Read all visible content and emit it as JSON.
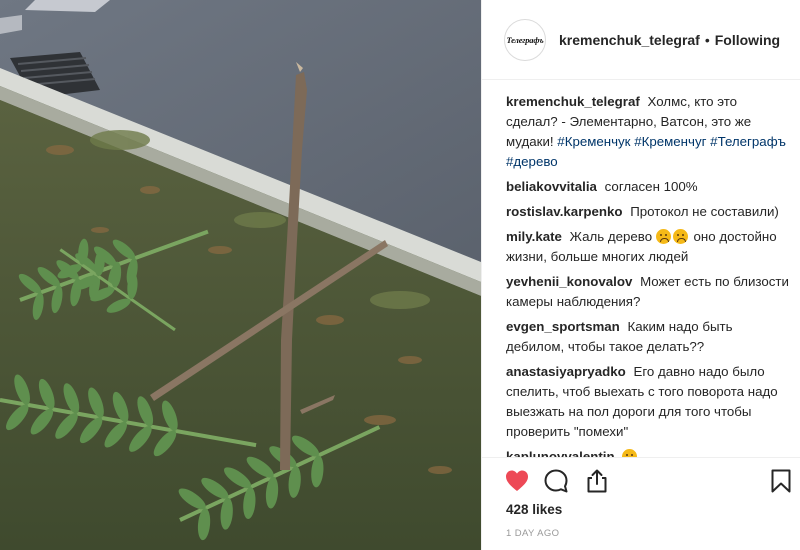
{
  "account": {
    "username": "kremenchuk_telegraf",
    "avatar_logo": "Телеграфъ",
    "follow_status": "Following",
    "separator": "•"
  },
  "comments": [
    {
      "user": "kremenchuk_telegraf",
      "text": "Холмс, кто это сделал? - Элементарно, Ватсон, это же мудаки!",
      "hashtags": [
        "#Кременчук",
        "#Кременчуг",
        "#Телеграфъ",
        "#дерево"
      ]
    },
    {
      "user": "beliakovvitalia",
      "text": "согласен 100%"
    },
    {
      "user": "rostislav.karpenko",
      "text": "Протокол не составили)"
    },
    {
      "user": "mily.kate",
      "text_before": "Жаль дерево",
      "emoji": [
        "sad-face",
        "sad-face"
      ],
      "text_after": "оно достойно жизни, больше многих людей"
    },
    {
      "user": "yevhenii_konovalov",
      "text": "Может есть по близости камеры наблюдения?"
    },
    {
      "user": "evgen_sportsman",
      "text": "Каким надо быть дебилом, чтобы такое делать??"
    },
    {
      "user": "anastasiyapryadko",
      "text": "Его давно надо было спелить, чтоб выехать с того поворота надо выезжать на пол дороги для того чтобы проверить \"помехи\""
    },
    {
      "user": "kaplunovvalentin",
      "emoji": [
        "sad-face"
      ]
    }
  ],
  "actions": {
    "like_icon": "heart-icon",
    "comment_icon": "speech-bubble-icon",
    "share_icon": "share-icon",
    "save_icon": "bookmark-icon",
    "liked": true,
    "like_color": "#ed4956"
  },
  "likes_label": "428 likes",
  "timestamp": "1 DAY AGO"
}
